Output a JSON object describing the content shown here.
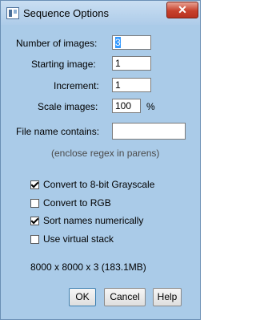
{
  "window": {
    "title": "Sequence Options",
    "close_glyph": "✕"
  },
  "fields": {
    "num_images": {
      "label": "Number of images:",
      "value": "3"
    },
    "start_image": {
      "label": "Starting image:",
      "value": "1"
    },
    "increment": {
      "label": "Increment:",
      "value": "1"
    },
    "scale": {
      "label": "Scale images:",
      "value": "100",
      "unit": "%"
    },
    "file_name": {
      "label": "File name contains:",
      "value": "",
      "hint": "(enclose regex in parens)"
    }
  },
  "checkboxes": [
    {
      "label": "Convert to 8-bit Grayscale",
      "checked": true
    },
    {
      "label": "Convert to RGB",
      "checked": false
    },
    {
      "label": "Sort names numerically",
      "checked": true
    },
    {
      "label": "Use virtual stack",
      "checked": false
    }
  ],
  "info": "8000 x 8000 x 3 (183.1MB)",
  "buttons": {
    "ok": "OK",
    "cancel": "Cancel",
    "help": "Help"
  }
}
